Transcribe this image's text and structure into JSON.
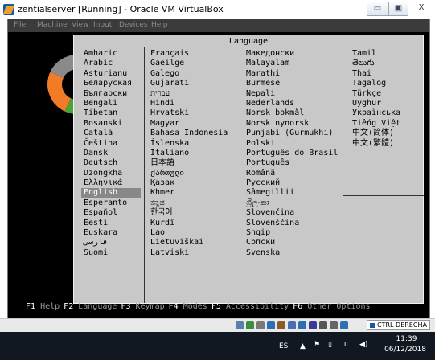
{
  "window": {
    "title": "zentialserver [Running] - Oracle VM VirtualBox",
    "minimize_glyph": "▭",
    "maximize_glyph": "▣",
    "close_glyph": "X"
  },
  "menubar": {
    "items": [
      "File",
      "Machine",
      "View",
      "Input",
      "Devices",
      "Help"
    ]
  },
  "dialog": {
    "title": "Language",
    "selected": "English",
    "columns": [
      [
        "Amharic",
        "Arabic",
        "Asturianu",
        "Беларуская",
        "Български",
        "Bengali",
        "Tibetan",
        "Bosanski",
        "Català",
        "Čeština",
        "Dansk",
        "Deutsch",
        "Dzongkha",
        "Ελληνικά",
        "English",
        "Esperanto",
        "Español",
        "Eesti",
        "Euskara",
        "فارسى",
        "Suomi"
      ],
      [
        "Français",
        "Gaeilge",
        "Galego",
        "Gujarati",
        "עברית",
        "Hindi",
        "Hrvatski",
        "Magyar",
        "Bahasa Indonesia",
        "Íslenska",
        "Italiano",
        "日本語",
        "ქართული",
        "Қазақ",
        "Khmer",
        "ಕನ್ನಡ",
        "한국어",
        "Kurdî",
        "Lao",
        "Lietuviškai",
        "Latviski"
      ],
      [
        "Македонски",
        "Malayalam",
        "Marathi",
        "Burmese",
        "Nepali",
        "Nederlands",
        "Norsk bokmål",
        "Norsk nynorsk",
        "Punjabi (Gurmukhi)",
        "Polski",
        "Português do Brasil",
        "Português",
        "Română",
        "Русский",
        "Sâmegillii",
        "ශ්‍රීලංකා",
        "Slovenčina",
        "Slovenščina",
        "Shqip",
        "Српски",
        "Svenska"
      ],
      [
        "Tamil",
        "తెలుగు",
        "Thai",
        "Tagalog",
        "Türkçe",
        "Uyghur",
        "Українська",
        "Tiếng Việt",
        "中文(简体)",
        "中文(繁體)"
      ]
    ]
  },
  "fkeys": [
    {
      "key": "F1",
      "label": "Help"
    },
    {
      "key": "F2",
      "label": "Language"
    },
    {
      "key": "F3",
      "label": "Keymap"
    },
    {
      "key": "F4",
      "label": "Modes"
    },
    {
      "key": "F5",
      "label": "Accessibility"
    },
    {
      "key": "F6",
      "label": "Other Options"
    }
  ],
  "statusbar": {
    "host_key": "CTRL DERECHA",
    "icons": [
      "hdd-icon",
      "optical-icon",
      "audio-icon",
      "network-icon",
      "usb-icon",
      "shared-folder-icon",
      "display-icon",
      "record-icon",
      "capture-icon",
      "mouse-icon",
      "keyboard-icon"
    ]
  },
  "taskbar": {
    "lang": "ES",
    "time": "11:39",
    "date": "06/12/2018"
  },
  "colors": {
    "vm_background": "#000000",
    "dialog_background": "#c8c8c8",
    "selection": "#888888",
    "logo_orange": "#f27b25",
    "logo_green": "#4aa336",
    "logo_gray": "#8a8a8a"
  }
}
